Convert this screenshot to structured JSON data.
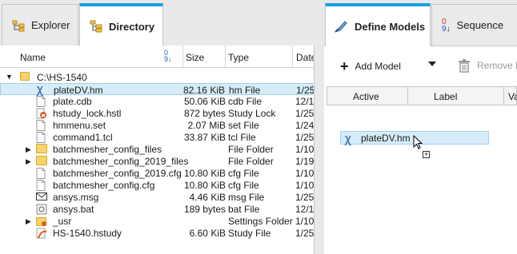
{
  "left_tabs": [
    {
      "label": "Explorer",
      "icon": "explorer-icon"
    },
    {
      "label": "Directory",
      "icon": "directory-icon",
      "active": true
    }
  ],
  "table": {
    "headers": {
      "name": "Name",
      "size": "Size",
      "type": "Type",
      "date": "Date"
    },
    "root": "C:\\HS-1540",
    "rows": [
      {
        "name": "plateDV.hm",
        "size": "82.16 KiB",
        "type": "hm File",
        "date": "1/25,",
        "icon": "hm-file-icon",
        "selected": true
      },
      {
        "name": "plate.cdb",
        "size": "50.06 KiB",
        "type": "cdb File",
        "date": "12/1",
        "icon": "cdb-file-icon"
      },
      {
        "name": "hstudy_lock.hstl",
        "size": "872 bytes",
        "type": "Study Lock",
        "date": "1/25,",
        "icon": "study-lock-icon"
      },
      {
        "name": "hmmenu.set",
        "size": "2.07 MiB",
        "type": "set File",
        "date": "1/24,",
        "icon": "set-file-icon"
      },
      {
        "name": "command1.tcl",
        "size": "33.87 KiB",
        "type": "tcl File",
        "date": "1/25,",
        "icon": "tcl-file-icon"
      },
      {
        "name": "batchmesher_config_files",
        "size": "",
        "type": "File Folder",
        "date": "1/10,",
        "icon": "folder-icon",
        "expandable": true
      },
      {
        "name": "batchmesher_config_2019_files",
        "size": "",
        "type": "File Folder",
        "date": "1/19,",
        "icon": "folder-icon",
        "expandable": true
      },
      {
        "name": "batchmesher_config_2019.cfg",
        "size": "10.80 KiB",
        "type": "cfg File",
        "date": "1/10,",
        "icon": "cfg-file-icon"
      },
      {
        "name": "batchmesher_config.cfg",
        "size": "10.80 KiB",
        "type": "cfg File",
        "date": "1/10,",
        "icon": "cfg-file-icon"
      },
      {
        "name": "ansys.msg",
        "size": "4.46 KiB",
        "type": "msg File",
        "date": "1/25,",
        "icon": "msg-file-icon"
      },
      {
        "name": "ansys.bat",
        "size": "189 bytes",
        "type": "bat File",
        "date": "12/1",
        "icon": "bat-file-icon"
      },
      {
        "name": "_usr",
        "size": "",
        "type": "Settings Folder",
        "date": "1/10,",
        "icon": "settings-folder-icon",
        "expandable": true
      },
      {
        "name": "HS-1540.hstudy",
        "size": "6.60 KiB",
        "type": "Study File",
        "date": "1/25,",
        "icon": "hstudy-file-icon"
      }
    ]
  },
  "right_tabs": [
    {
      "label": "Define Models",
      "icon": "define-models-icon",
      "active": true
    },
    {
      "label": "Sequence",
      "icon": "sequence-icon"
    }
  ],
  "toolbar": {
    "add_label": "Add Model",
    "remove_label": "Remove M"
  },
  "models_table": {
    "headers": [
      "Active",
      "Label",
      "Va"
    ]
  },
  "drag_item": {
    "label": "plateDV.hm"
  },
  "colors": {
    "accent": "#1ba1e2",
    "selection": "#d7ecf8"
  }
}
